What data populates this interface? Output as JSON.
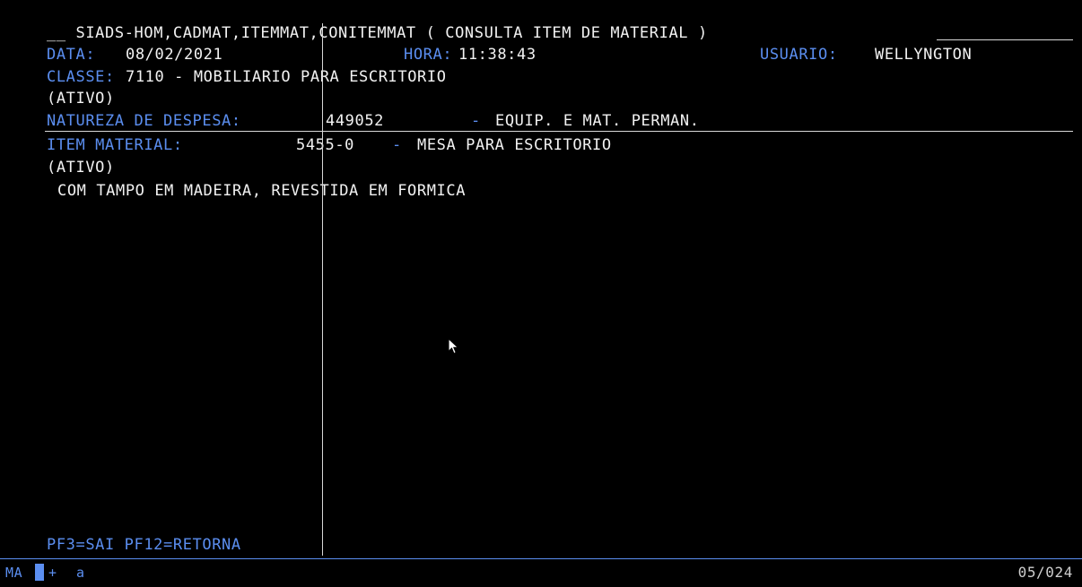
{
  "header": {
    "prefix": "__",
    "title": "SIADS-HOM,CADMAT,ITEMMAT,CONITEMMAT ( CONSULTA ITEM DE MATERIAL )"
  },
  "info": {
    "data_label": "DATA:",
    "data_value": "08/02/2021",
    "hora_label": "HORA:",
    "hora_value": "11:38:43",
    "usuario_label": "USUARIO:",
    "usuario_value": "WELLYNGTON"
  },
  "classe": {
    "label": "CLASSE:",
    "value": "7110 - MOBILIARIO PARA ESCRITORIO",
    "status": "(ATIVO)"
  },
  "natureza": {
    "label": "NATUREZA DE DESPESA:",
    "code": "449052",
    "dash": "-",
    "description": "EQUIP. E MAT. PERMAN."
  },
  "item": {
    "label": "ITEM MATERIAL:",
    "code": "5455-0",
    "dash": "-",
    "name": "MESA PARA ESCRITORIO",
    "status": "(ATIVO)",
    "description": "COM TAMPO EM MADEIRA, REVESTIDA EM FORMICA"
  },
  "function_keys": "PF3=SAI PF12=RETORNA",
  "oia": {
    "mode": "MA",
    "plus": "+",
    "letter": "a",
    "cursor_position": "05/024"
  },
  "colors": {
    "background": "#000000",
    "label": "#5b8ef0",
    "value": "#f2f2f2",
    "rule": "#d8d8d8"
  },
  "icons": {
    "pointer": "mouse-pointer-icon"
  }
}
